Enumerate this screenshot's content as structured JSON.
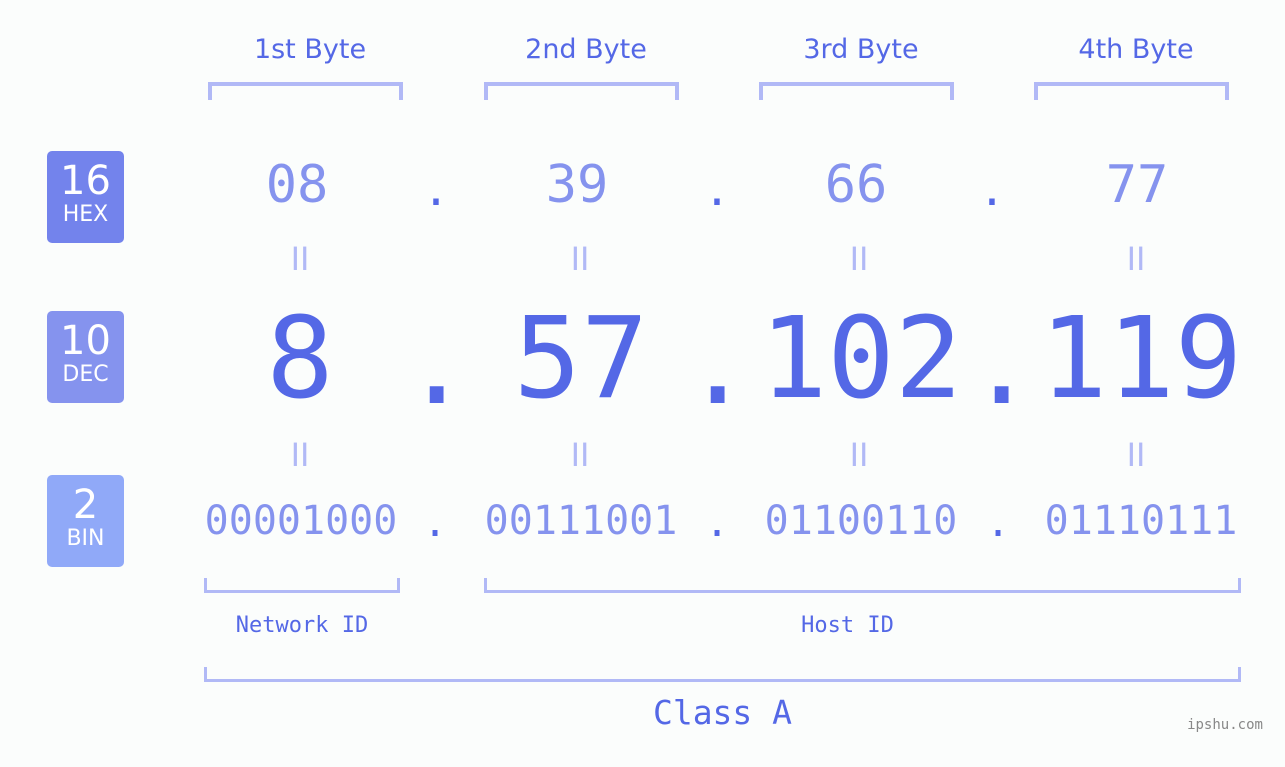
{
  "bytes": [
    {
      "header": "1st Byte",
      "hex": "08",
      "dec": "8",
      "bin": "00001000"
    },
    {
      "header": "2nd Byte",
      "hex": "39",
      "dec": "57",
      "bin": "00111001"
    },
    {
      "header": "3rd Byte",
      "hex": "66",
      "dec": "102",
      "bin": "01100110"
    },
    {
      "header": "4th Byte",
      "hex": "77",
      "dec": "119",
      "bin": "01110111"
    }
  ],
  "badges": {
    "hex": {
      "number": "16",
      "label": "HEX",
      "color": "#7383ec"
    },
    "dec": {
      "number": "10",
      "label": "DEC",
      "color": "#8593ee"
    },
    "bin": {
      "number": "2",
      "label": "BIN",
      "color": "#90a9f8"
    }
  },
  "separator": ".",
  "equals": "II",
  "network_id_label": "Network ID",
  "host_id_label": "Host ID",
  "class_label": "Class A",
  "watermark": "ipshu.com"
}
